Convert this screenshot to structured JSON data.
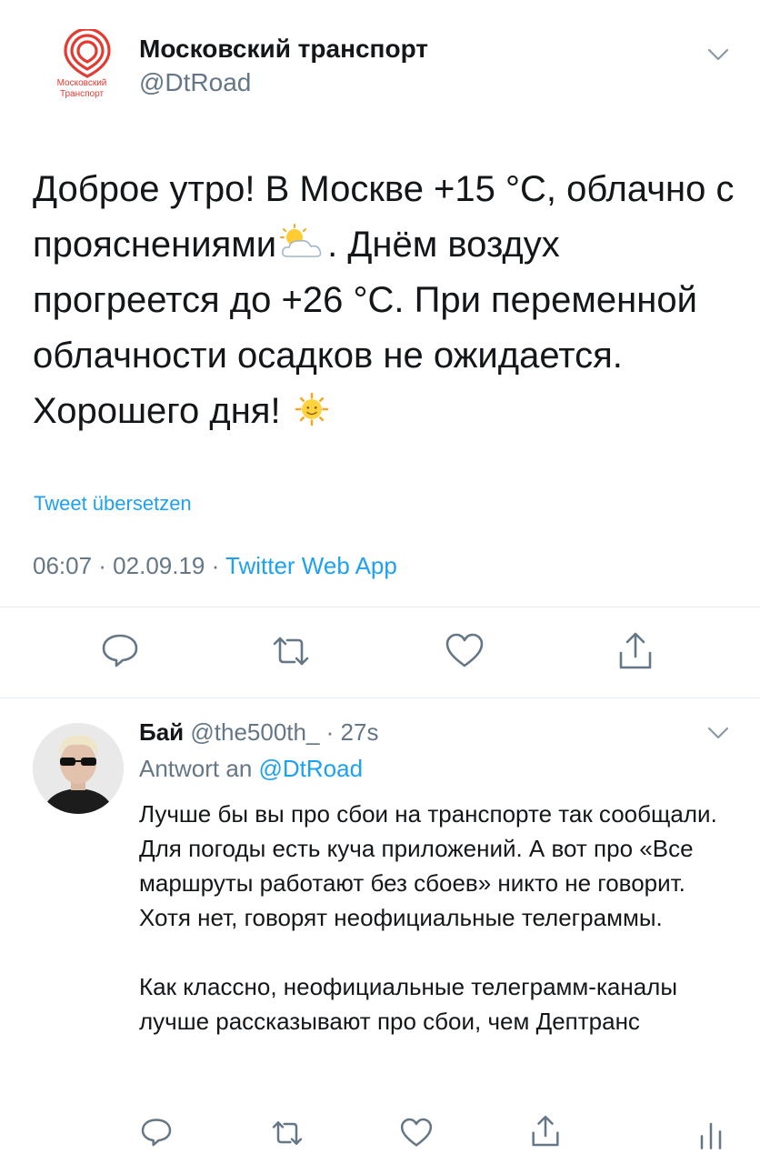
{
  "main_tweet": {
    "logo_text_line1": "Московский",
    "logo_text_line2": "Транспорт",
    "display_name": "Московский транспорт",
    "handle": "@DtRoad",
    "text_part1": "Доброе утро! В Москве +15 °С, облачно с прояснениями",
    "text_part2": ". Днём воздух прогреется до +26 °С. При переменной облачности осадков не ожидается. Хорошего дня!",
    "translate_label": "Tweet übersetzen",
    "time": "06:07 · 02.09.19 · ",
    "source": "Twitter Web App",
    "actions": [
      "reply-icon",
      "retweet-icon",
      "like-icon",
      "share-icon"
    ]
  },
  "reply_tweet": {
    "display_name": "Бай",
    "handle": "@the500th_",
    "time": " · 27s",
    "reply_prefix": "Antwort an ",
    "reply_to": "@DtRoad",
    "paragraph1": "Лучше бы вы про сбои на транспорте так сообщали. Для погоды есть куча приложений. А вот про «Все маршруты работают без сбоев» никто не говорит. Хотя нет, говорят неофициальные телеграммы.",
    "paragraph2": "Как классно, неофициальные телеграмм-каналы лучше рассказывают про сбои, чем Дептранс",
    "actions": [
      "reply-icon",
      "retweet-icon",
      "like-icon",
      "share-icon",
      "analytics-icon"
    ]
  },
  "colors": {
    "accent": "#1da1f2",
    "secondary_text": "#657786",
    "brand_red": "#e43a32",
    "divider": "#e6ecf0"
  }
}
